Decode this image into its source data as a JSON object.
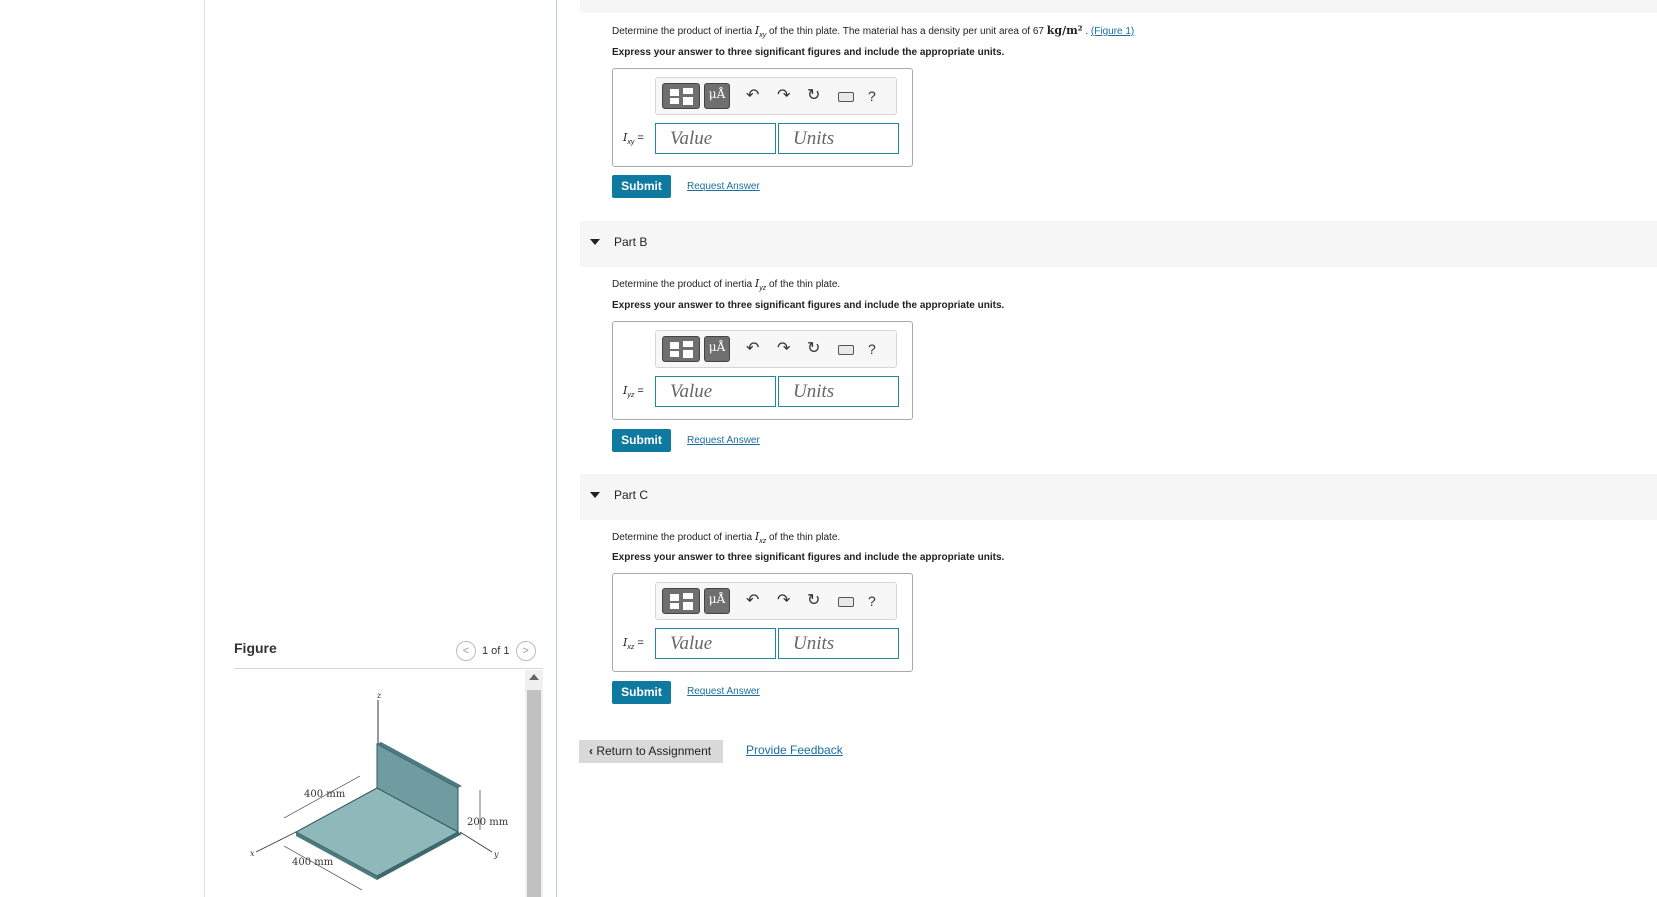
{
  "figure_panel": {
    "title": "Figure",
    "pager": {
      "prev_icon": "chevron-left-icon",
      "text": "1 of 1",
      "next_icon": "chevron-right-icon"
    },
    "diagram": {
      "axis_z": "z",
      "axis_x": "x",
      "axis_y": "y",
      "dim_400a": "400 mm",
      "dim_400b": "400 mm",
      "dim_200": "200 mm"
    }
  },
  "part_a": {
    "question_pre": "Determine the product of inertia ",
    "question_var": "I",
    "question_sub": "xy",
    "question_mid": " of the thin plate. The material has a density per unit area of 67 ",
    "question_unit": "kg/m²",
    "question_post": " . ",
    "figure_link": "(Figure 1)",
    "instruction": "Express your answer to three significant figures and include the appropriate units.",
    "var_label": "I",
    "var_sub": "xy",
    "equals": "=",
    "value_placeholder": "Value",
    "units_placeholder": "Units",
    "submit": "Submit",
    "request": "Request Answer"
  },
  "part_b": {
    "label": "Part B",
    "question_pre": "Determine the product of inertia ",
    "question_var": "I",
    "question_sub": "yz",
    "question_post": " of the thin plate.",
    "instruction": "Express your answer to three significant figures and include the appropriate units.",
    "var_label": "I",
    "var_sub": "yz",
    "equals": "=",
    "value_placeholder": "Value",
    "units_placeholder": "Units",
    "submit": "Submit",
    "request": "Request Answer"
  },
  "part_c": {
    "label": "Part C",
    "question_pre": "Determine the product of inertia ",
    "question_var": "I",
    "question_sub": "xz",
    "question_post": " of the thin plate.",
    "instruction": "Express your answer to three significant figures and include the appropriate units.",
    "var_label": "I",
    "var_sub": "xz",
    "equals": "=",
    "value_placeholder": "Value",
    "units_placeholder": "Units",
    "submit": "Submit",
    "request": "Request Answer"
  },
  "toolbar": {
    "mu_label": "μÅ",
    "help": "?"
  },
  "footer": {
    "return": "Return to Assignment",
    "feedback": "Provide Feedback"
  },
  "colors": {
    "accent": "#0e7aa0",
    "link": "#1a6fa0",
    "input_border": "#1f86a4",
    "plate": "#8fb8bb"
  }
}
